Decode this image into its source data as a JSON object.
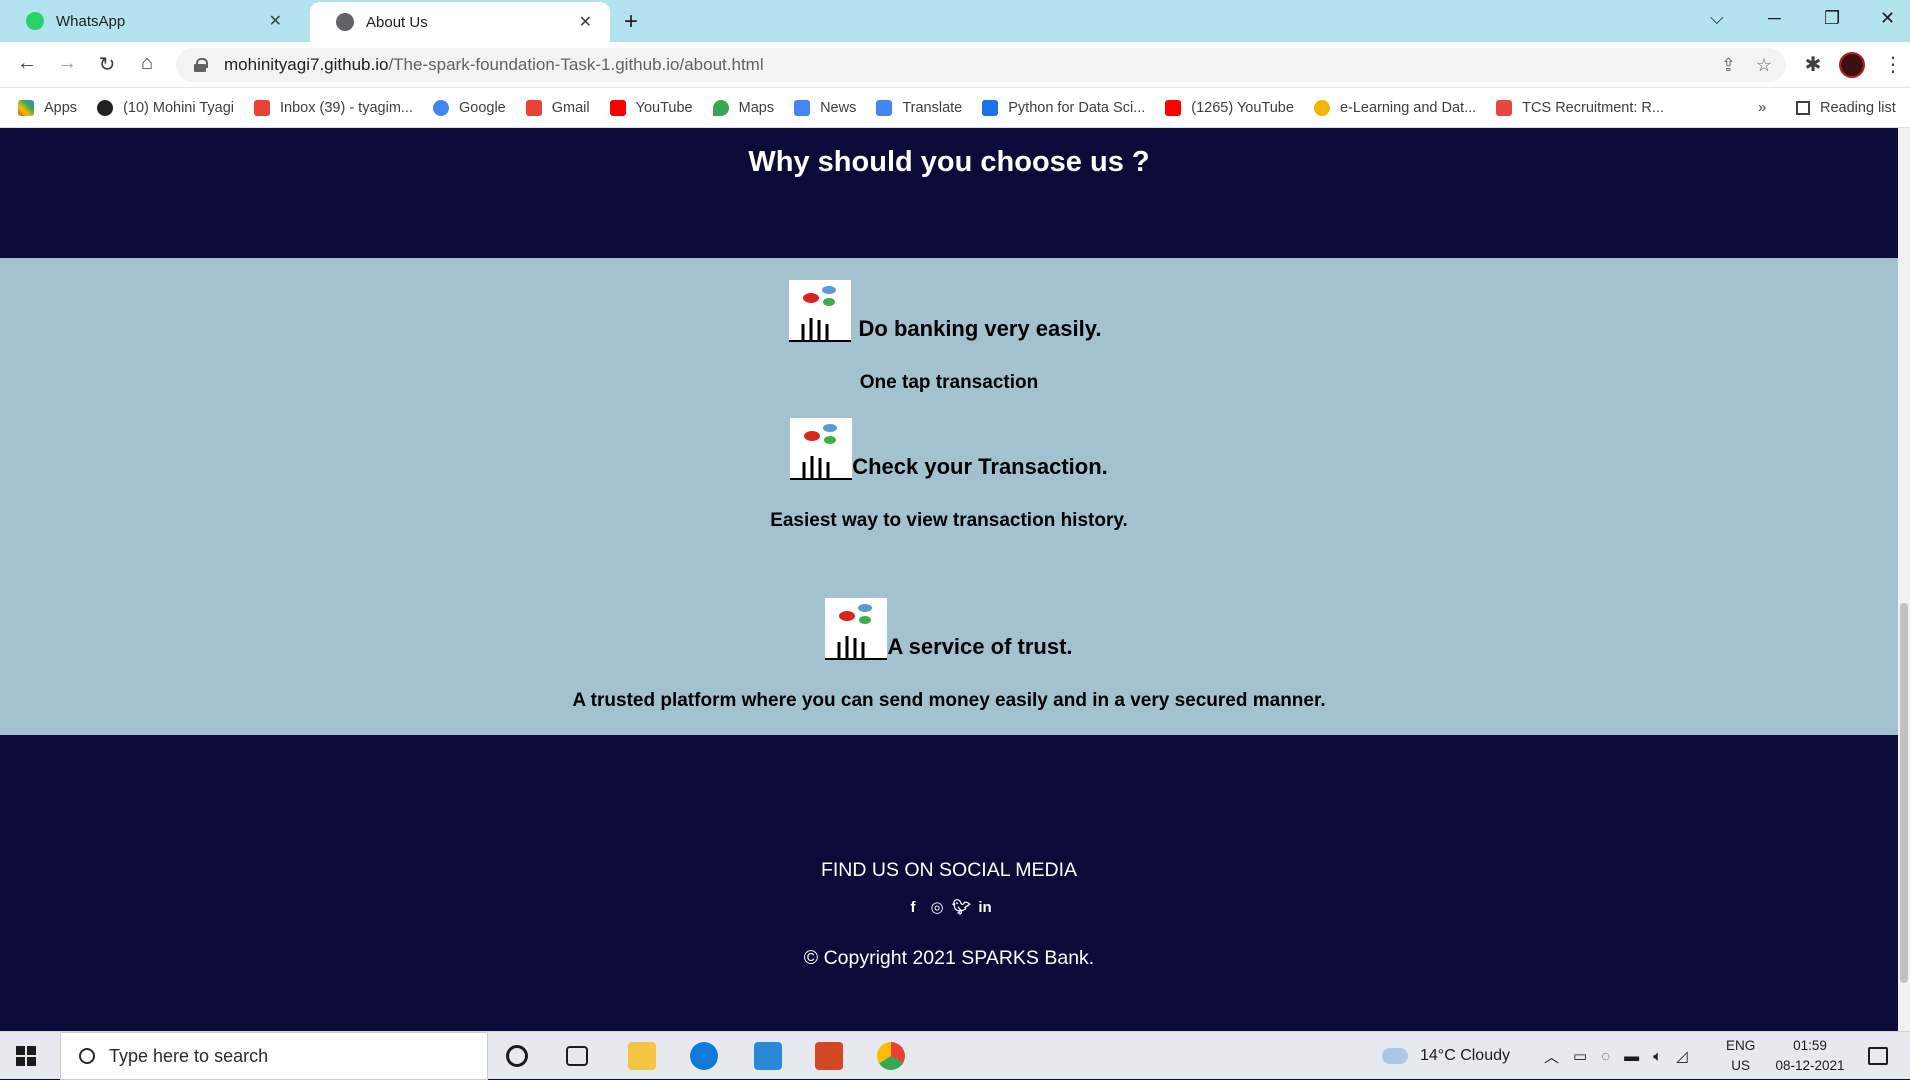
{
  "browser": {
    "tabs": [
      {
        "title": "WhatsApp",
        "active": false,
        "icon": "whatsapp-icon"
      },
      {
        "title": "About Us",
        "active": true,
        "icon": "globe-icon"
      }
    ],
    "url_host": "mohinityagi7.github.io",
    "url_path": "/The-spark-foundation-Task-1.github.io/about.html",
    "bookmarks": [
      "Apps",
      "(10) Mohini Tyagi",
      "Inbox (39) - tyagim...",
      "Google",
      "Gmail",
      "YouTube",
      "Maps",
      "News",
      "Translate",
      "Python for Data Sci...",
      "(1265) YouTube",
      "e-Learning and Dat...",
      "TCS Recruitment: R..."
    ],
    "more": "»",
    "reading_list": "Reading list"
  },
  "page": {
    "heading": "Why should you choose us ?",
    "features": [
      {
        "title": "Do banking very easily.",
        "subtitle": "One tap transaction"
      },
      {
        "title": "Check your Transaction.",
        "subtitle": "Easiest way to view transaction history."
      },
      {
        "title": "A service of trust.",
        "subtitle": "A trusted platform where you can send money easily and in a very secured manner."
      }
    ],
    "footer": {
      "find_us": "FIND US ON SOCIAL MEDIA",
      "social_icons": [
        "facebook-icon",
        "instagram-icon",
        "twitter-icon",
        "linkedin-icon"
      ],
      "copyright": "© Copyright 2021 SPARKS Bank."
    }
  },
  "taskbar": {
    "search_placeholder": "Type here to search",
    "weather": "14°C  Cloudy",
    "lang_top": "ENG",
    "lang_bottom": "US",
    "time": "01:59",
    "date": "08-12-2021"
  },
  "colors": {
    "navy": "#0b0b3a",
    "feature_bg": "#a2c2d0",
    "tabbar": "#b3e3ef"
  }
}
